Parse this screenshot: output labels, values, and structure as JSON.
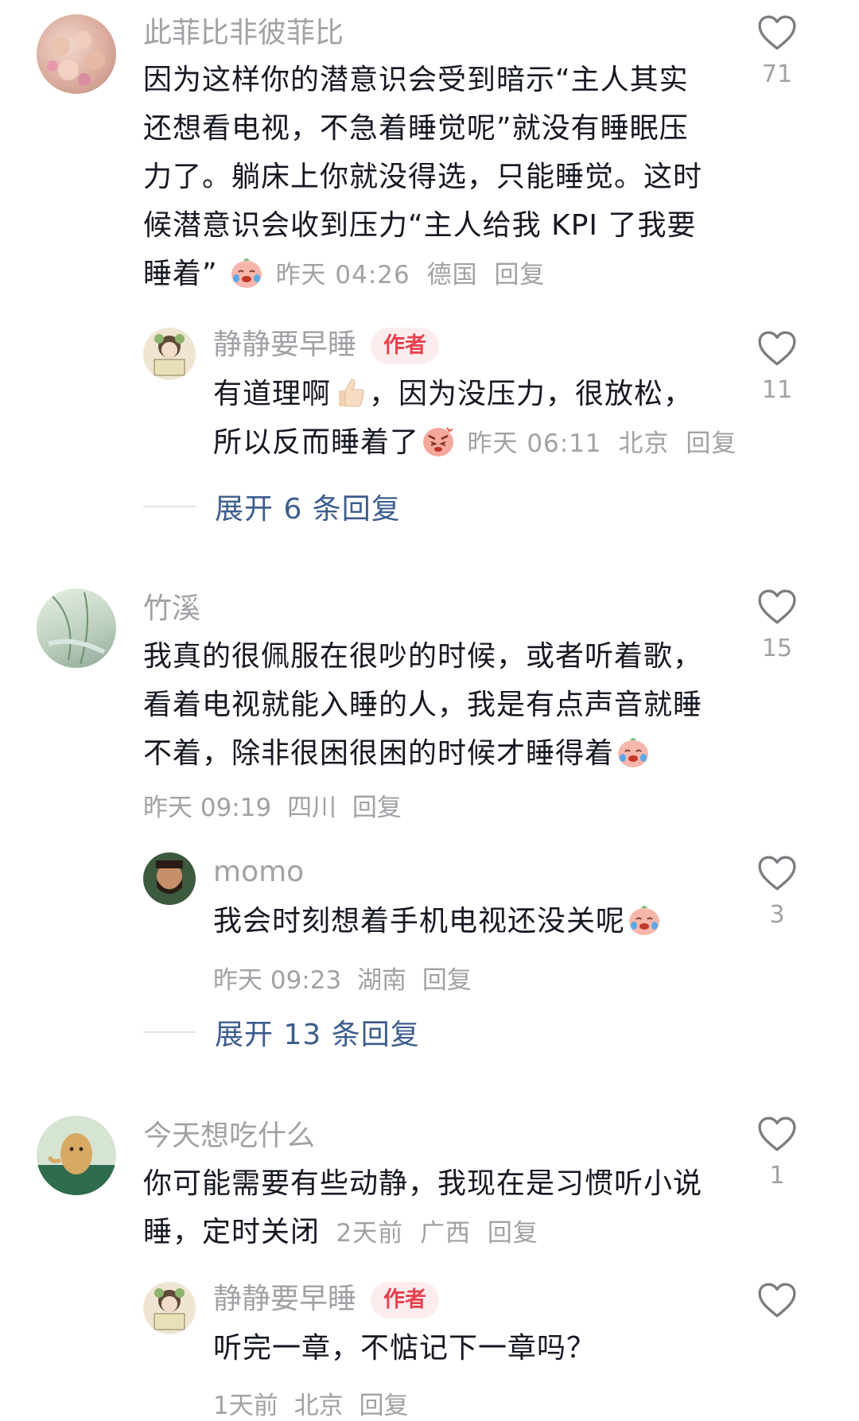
{
  "comments": [
    {
      "user": "此菲比非彼菲比",
      "text": "因为这样你的潜意识会受到暗示“主人其实还想看电视，不急着睡觉呢”就没有睡眠压力了。躺床上你就没得选，只能睡觉。这时候潜意识会收到压力“主人给我 KPI 了我要睡着”",
      "text_lines": [
        "因为这样你的潜意识会受到暗示“主人其实",
        "还想看电视，不急着睡觉呢”就没有睡眠压",
        "力了。躺床上你就没得选，只能睡觉。这时",
        "候潜意识会收到压力“主人给我 KPI 了我要",
        "睡着”"
      ],
      "emoji": "crying-laughing-emoji",
      "time": "昨天 04:26",
      "location": "德国",
      "reply_label": "回复",
      "likes": "71",
      "reply": {
        "user": "静静要早睡",
        "badge": "作者",
        "text_lines": [
          "有道理啊",
          "，因为没压力，很放松，",
          "所以反而睡着了"
        ],
        "emoji1": "thumbs-up-emoji",
        "emoji2": "angry-emoji",
        "time": "昨天 06:11",
        "location": "北京",
        "reply_label": "回复",
        "likes": "11"
      },
      "expand_label": "展开 6 条回复"
    },
    {
      "user": "竹溪",
      "text_lines": [
        "我真的很佩服在很吵的时候，或者听着歌，",
        "看着电视就能入睡的人，我是有点声音就睡",
        "不着，除非很困很困的时候才睡得着"
      ],
      "emoji": "crying-emoji",
      "time": "昨天 09:19",
      "location": "四川",
      "reply_label": "回复",
      "likes": "15",
      "reply": {
        "user": "momo",
        "text_lines": [
          "我会时刻想着手机电视还没关呢"
        ],
        "emoji": "crying-emoji",
        "time": "昨天 09:23",
        "location": "湖南",
        "reply_label": "回复",
        "likes": "3"
      },
      "expand_label": "展开 13 条回复"
    },
    {
      "user": "今天想吃什么",
      "text_lines": [
        "你可能需要有些动静，我现在是习惯听小说",
        "睡，定时关闭"
      ],
      "time": "2天前",
      "location": "广西",
      "reply_label": "回复",
      "likes": "1",
      "reply": {
        "user": "静静要早睡",
        "badge": "作者",
        "text_lines": [
          "听完一章，不惦记下一章吗？"
        ],
        "time": "1天前",
        "location": "北京",
        "reply_label": "回复",
        "likes": ""
      }
    }
  ],
  "colors": {
    "text": "#161823",
    "muted": "#a1a1a6",
    "link": "#3c5d8c",
    "badge": "#e8414d"
  }
}
